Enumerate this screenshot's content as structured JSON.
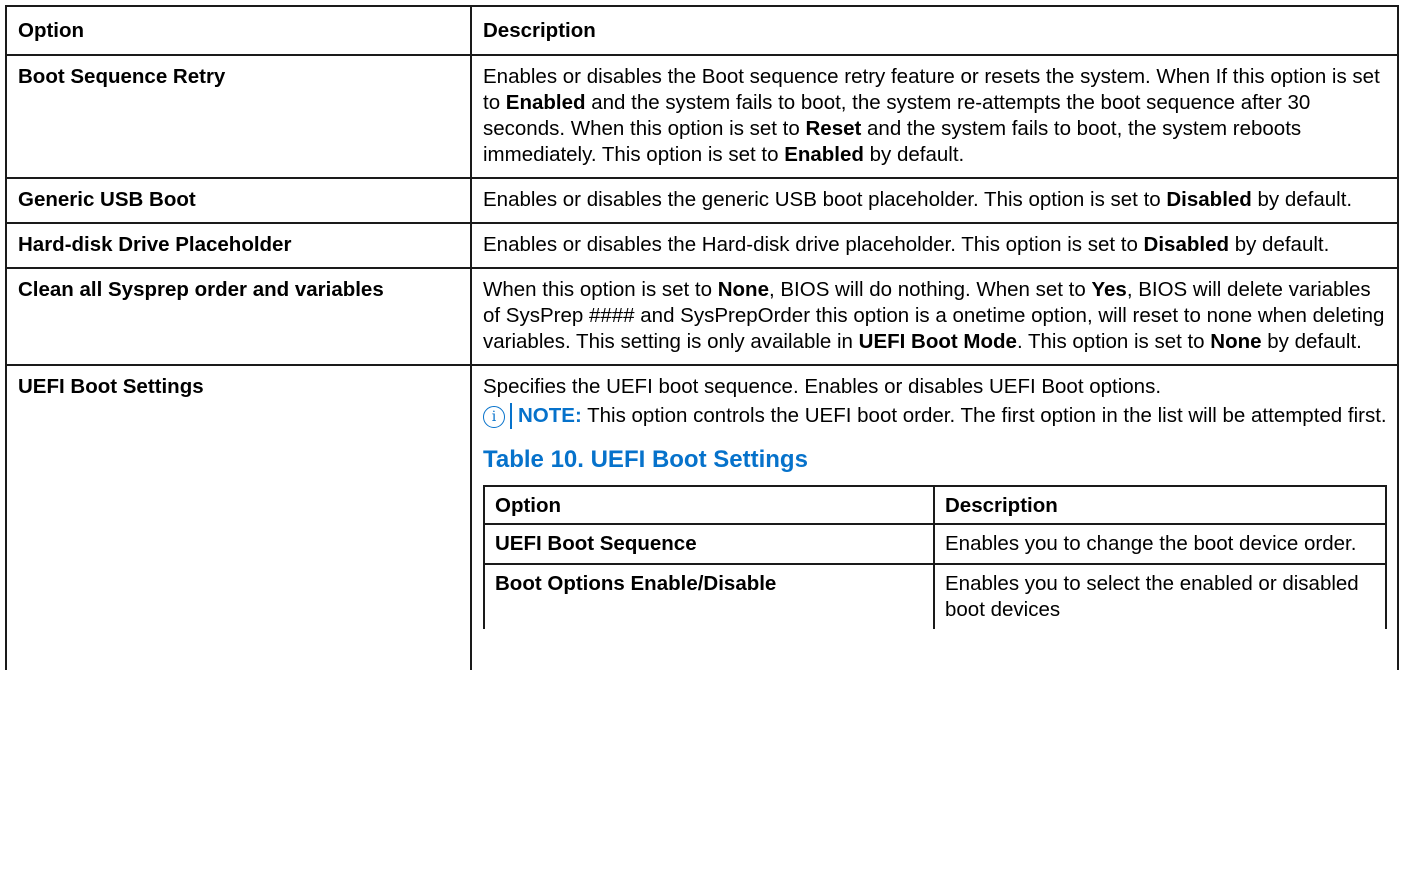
{
  "header": {
    "option": "Option",
    "description": "Description"
  },
  "rows": [
    {
      "option": "Boot Sequence Retry",
      "desc": [
        "Enables or disables the Boot sequence retry feature or resets the system. When If this option is set to ",
        "Enabled",
        " and the system fails to boot, the system re-attempts the boot sequence after 30 seconds. When this option is set to ",
        "Reset",
        " and the system fails to boot, the system reboots immediately. This option is set to ",
        "Enabled",
        " by default."
      ]
    },
    {
      "option": "Generic USB Boot",
      "desc": [
        "Enables or disables the generic USB boot placeholder. This option is set to ",
        "Disabled",
        " by default."
      ]
    },
    {
      "option": "Hard-disk Drive Placeholder",
      "desc": [
        "Enables or disables the Hard-disk drive placeholder. This option is set to ",
        "Disabled",
        " by default."
      ]
    },
    {
      "option": "Clean all Sysprep order and variables",
      "desc": [
        "When this option is set to ",
        "None",
        ", BIOS will do nothing. When set to ",
        "Yes",
        ", BIOS will delete variables of SysPrep #### and SysPrepOrder this option is a onetime option, will reset to none when deleting variables. This setting is only available in ",
        "UEFI Boot Mode",
        ". This option is set to ",
        "None",
        " by default."
      ]
    },
    {
      "option": "UEFI Boot Settings",
      "desc_intro": "Specifies the UEFI boot sequence. Enables or disables UEFI Boot options.",
      "note": {
        "label": "NOTE:",
        "text": " This option controls the UEFI boot order. The first option in the list will be attempted first."
      },
      "subtable": {
        "title": "Table 10. UEFI Boot Settings",
        "header": {
          "option": "Option",
          "description": "Description"
        },
        "rows": [
          {
            "option": "UEFI Boot Sequence",
            "description": "Enables you to change the boot device order."
          },
          {
            "option": "Boot Options Enable/Disable",
            "description": "Enables you to select the enabled or disabled boot devices"
          }
        ]
      }
    }
  ],
  "icons": {
    "note": "info-circle-icon"
  },
  "colors": {
    "accent": "#0672cb",
    "border": "#1a1a1a"
  }
}
